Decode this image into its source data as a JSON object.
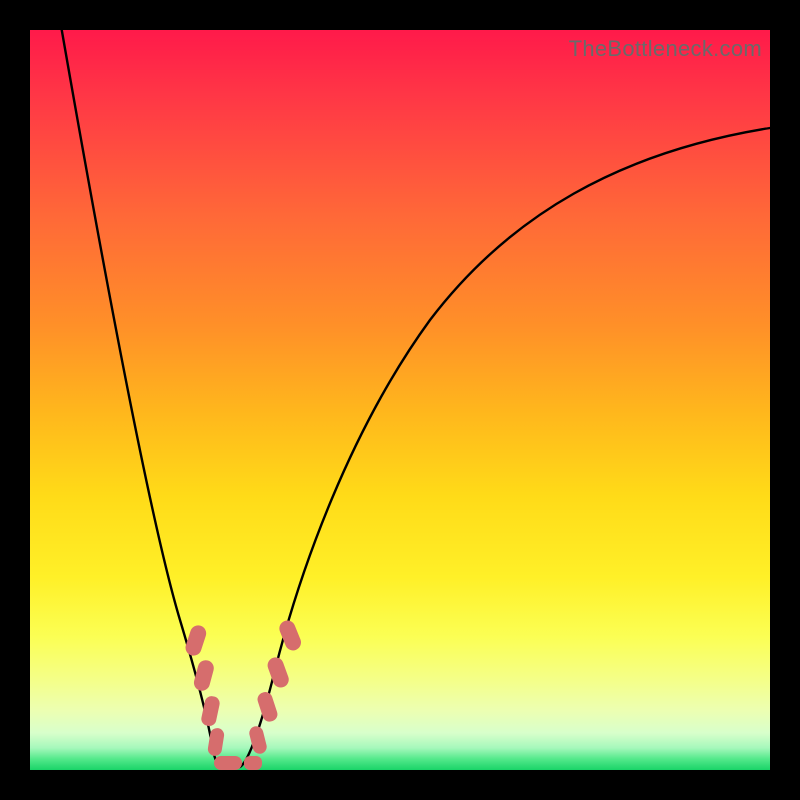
{
  "watermark": "TheBottleneck.com",
  "colors": {
    "frame": "#000000",
    "curve": "#000000",
    "data_point": "#d66d6d",
    "gradient_top": "#ff1a4a",
    "gradient_mid": "#ffdb18",
    "gradient_bottom": "#1ad468",
    "watermark_text": "#6a6a6a"
  },
  "chart_data": {
    "type": "line",
    "title": "",
    "xlabel": "",
    "ylabel": "",
    "xlim": [
      0,
      100
    ],
    "ylim": [
      0,
      100
    ],
    "grid": false,
    "legend": false,
    "background": "vertical red→yellow→green gradient (higher = worse / red, lower = better / green)",
    "note": "Axes are unlabeled in the source image; x and y are normalized 0–100 percentage estimates read from pixel positions within the plot box.",
    "series": [
      {
        "name": "left_branch",
        "x": [
          4,
          6,
          8,
          10,
          12,
          14,
          16,
          18,
          20,
          22,
          24,
          26
        ],
        "y": [
          101,
          90,
          78,
          66,
          54,
          43,
          33,
          24,
          16,
          10,
          5,
          1
        ]
      },
      {
        "name": "right_branch",
        "x": [
          28,
          30,
          32,
          35,
          40,
          45,
          50,
          55,
          60,
          70,
          80,
          90,
          100
        ],
        "y": [
          1,
          5,
          12,
          22,
          36,
          47,
          55,
          62,
          68,
          77,
          82,
          85,
          87
        ]
      }
    ],
    "highlighted_points": {
      "name": "coral_beads",
      "description": "Rounded-rectangle markers along both branches near the curve minimum / green zone",
      "approx_xy": [
        [
          22,
          19
        ],
        [
          23,
          14
        ],
        [
          24,
          9
        ],
        [
          25,
          5
        ],
        [
          26,
          1
        ],
        [
          29,
          1
        ],
        [
          30,
          4
        ],
        [
          31,
          9
        ],
        [
          33,
          14
        ],
        [
          34,
          19
        ]
      ]
    },
    "minimum": {
      "x": 27,
      "y": 0.5
    }
  }
}
